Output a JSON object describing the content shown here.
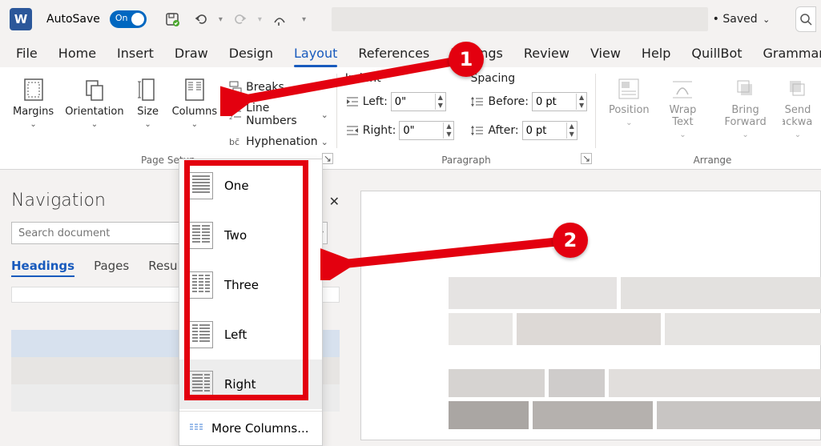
{
  "titlebar": {
    "autosave_label": "AutoSave",
    "toggle_text": "On",
    "saved_label": "Saved",
    "doc_title": ""
  },
  "tabs": {
    "file": "File",
    "home": "Home",
    "insert": "Insert",
    "draw": "Draw",
    "design": "Design",
    "layout": "Layout",
    "references": "References",
    "mailings": "Mailings",
    "review": "Review",
    "view": "View",
    "help": "Help",
    "quillbot": "QuillBot",
    "grammarly": "Grammarly"
  },
  "ribbon": {
    "margins": "Margins",
    "orientation": "Orientation",
    "size": "Size",
    "columns": "Columns",
    "breaks": "Breaks",
    "line_numbers": "Line Numbers",
    "hyphenation": "Hyphenation",
    "page_setup_group": "Page Setup",
    "indent_header": "Indent",
    "left_label": "Left:",
    "right_label": "Right:",
    "indent_left_val": "0\"",
    "indent_right_val": "0\"",
    "spacing_header": "Spacing",
    "before_label": "Before:",
    "after_label": "After:",
    "before_val": "0 pt",
    "after_val": "0 pt",
    "paragraph_group": "Paragraph",
    "position": "Position",
    "wrap_text": "Wrap Text",
    "bring_forward": "Bring Forward",
    "send_backward": "Send Backward",
    "arrange_group": "Arrange"
  },
  "columns_menu": {
    "one": "One",
    "two": "Two",
    "three": "Three",
    "left": "Left",
    "right": "Right",
    "more": "More Columns..."
  },
  "navpane": {
    "title": "Navigation",
    "search_placeholder": "Search document",
    "headings": "Headings",
    "pages": "Pages",
    "results": "Results"
  },
  "callouts": {
    "one": "1",
    "two": "2"
  }
}
